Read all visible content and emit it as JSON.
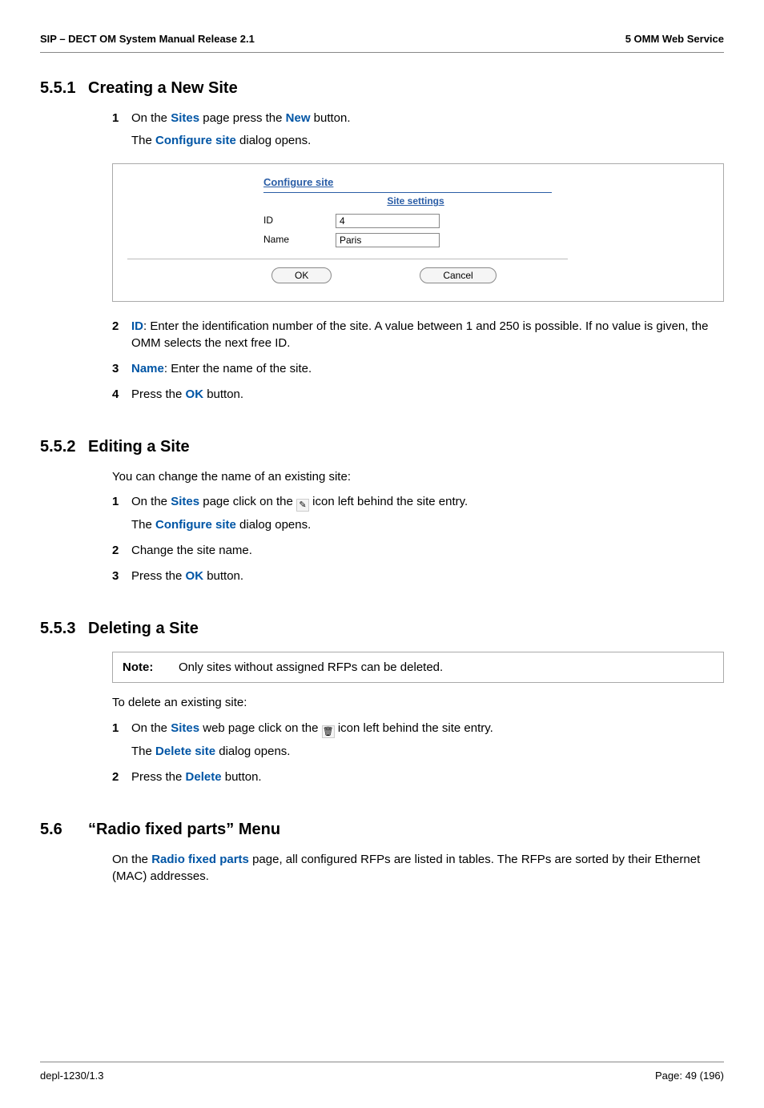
{
  "header": {
    "left": "SIP – DECT OM System Manual Release 2.1",
    "right": "5 OMM Web Service"
  },
  "s551": {
    "num": "5.5.1",
    "title": "Creating a New Site",
    "step1_a": "On the ",
    "step1_sites": "Sites",
    "step1_b": " page press the ",
    "step1_new": "New",
    "step1_c": " button.",
    "step1_d": "The ",
    "step1_conf": "Configure site",
    "step1_e": " dialog opens.",
    "fig": {
      "title": "Configure site",
      "subhead": "Site settings",
      "id_label": "ID",
      "id_value": "4",
      "name_label": "Name",
      "name_value": "Paris",
      "ok": "OK",
      "cancel": "Cancel"
    },
    "step2_id": "ID",
    "step2_text": ": Enter the identification number of the site. A value between 1 and 250 is possible. If no value is given, the OMM selects the next free ID.",
    "step3_name": "Name",
    "step3_text": ": Enter the name of the site.",
    "step4_a": "Press the ",
    "step4_ok": "OK",
    "step4_b": " button."
  },
  "s552": {
    "num": "5.5.2",
    "title": "Editing a Site",
    "intro": "You can change the name of an existing site:",
    "step1_a": "On the ",
    "step1_sites": "Sites",
    "step1_b": " page click on the ",
    "step1_c": " icon left behind the site entry.",
    "step1_d": "The ",
    "step1_conf": "Configure site",
    "step1_e": " dialog opens.",
    "step2": "Change the site name.",
    "step3_a": "Press the ",
    "step3_ok": "OK",
    "step3_b": " button."
  },
  "s553": {
    "num": "5.5.3",
    "title": "Deleting a Site",
    "note_label": "Note:",
    "note_text": "Only sites without assigned RFPs can be deleted.",
    "intro": "To delete an existing site:",
    "step1_a": "On the ",
    "step1_sites": "Sites",
    "step1_b": " web page click on the ",
    "step1_c": " icon left behind the site entry.",
    "step1_d": "The ",
    "step1_del": "Delete site",
    "step1_e": " dialog opens.",
    "step2_a": "Press the ",
    "step2_del": "Delete",
    "step2_b": " button."
  },
  "s56": {
    "num": "5.6",
    "title": "“Radio fixed parts” Menu",
    "p_a": "On the ",
    "p_rfp": "Radio fixed parts",
    "p_b": " page, all configured RFPs are listed in tables. The RFPs are sorted by their Ethernet (MAC) addresses."
  },
  "footer": {
    "left": "depl-1230/1.3",
    "right": "Page: 49 (196)"
  }
}
